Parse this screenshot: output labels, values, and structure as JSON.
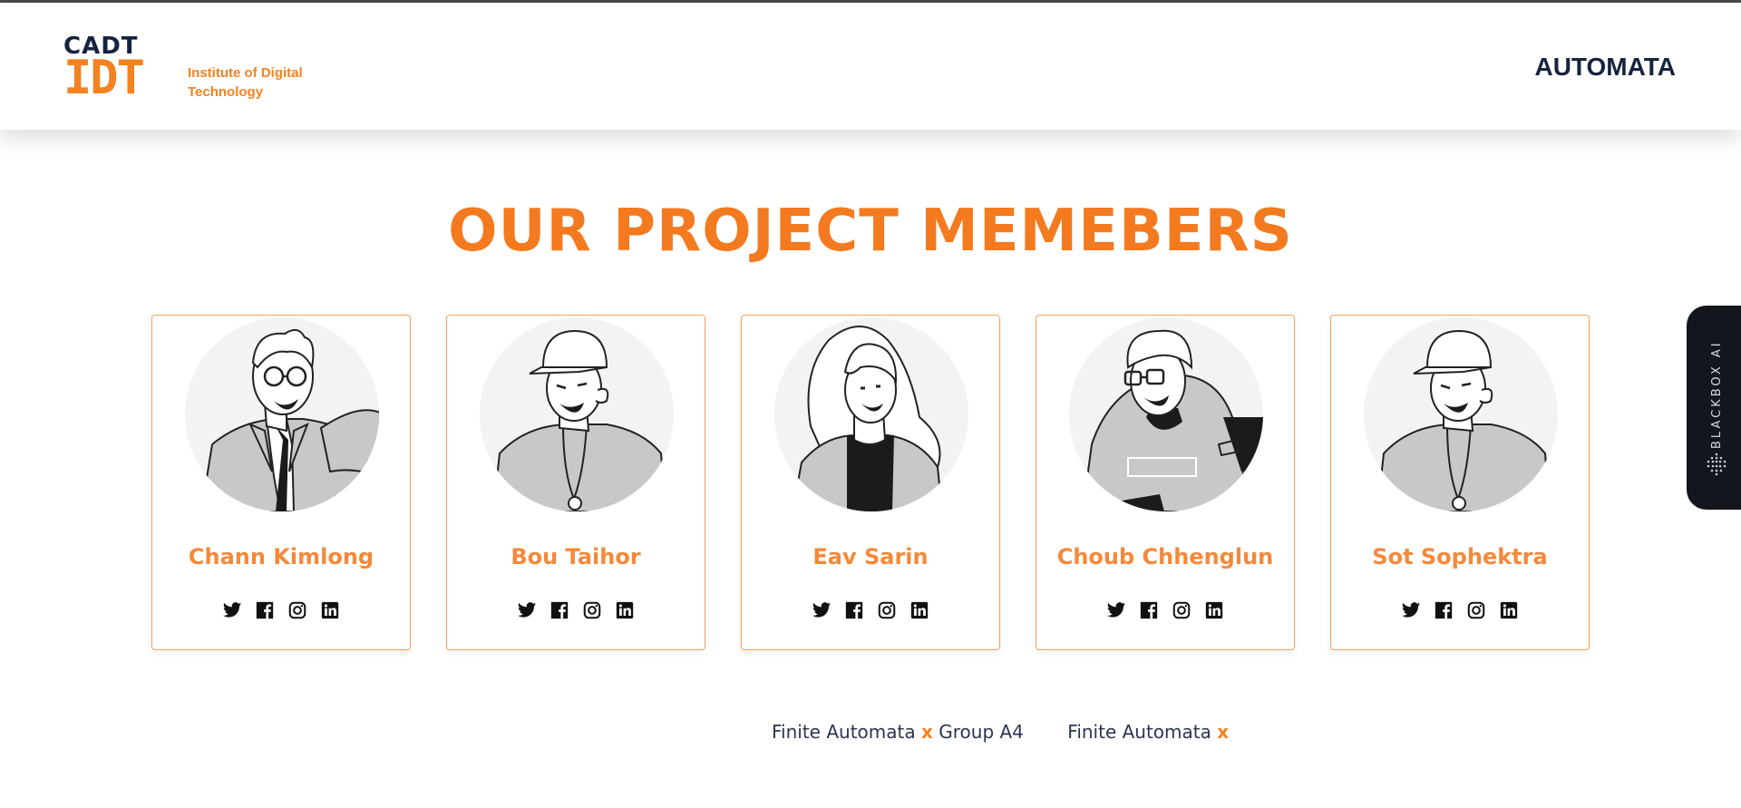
{
  "header": {
    "logo": {
      "top": "CADT",
      "main": "IDT",
      "subtitle": "Institute of Digital Technology"
    },
    "brand": "AUTOMATA"
  },
  "page_title": "OUR PROJECT MEMEBERS",
  "members": [
    {
      "name": "Chann Kimlong",
      "avatar_icon": "businessman-glasses-avatar"
    },
    {
      "name": "Bou Taihor",
      "avatar_icon": "cap-guy-avatar"
    },
    {
      "name": "Eav Sarin",
      "avatar_icon": "long-hair-woman-avatar"
    },
    {
      "name": "Choub Chhenglun",
      "avatar_icon": "hoodie-glasses-avatar"
    },
    {
      "name": "Sot Sophektra",
      "avatar_icon": "cap-guy-avatar"
    }
  ],
  "social_icons": [
    "twitter-icon",
    "facebook-icon",
    "instagram-icon",
    "linkedin-icon"
  ],
  "footer": {
    "seg1_left": "Finite Automata",
    "seg1_x": "x",
    "seg1_right": "Group A4",
    "seg2_left": "Finite Automata",
    "seg2_x": "x"
  },
  "side_widget": {
    "label": "BLACKBOX AI"
  },
  "colors": {
    "accent": "#f58220",
    "title": "#f47a1f",
    "navy": "#16233f",
    "card_border": "#f8a05b",
    "widget_bg": "#13161c"
  }
}
